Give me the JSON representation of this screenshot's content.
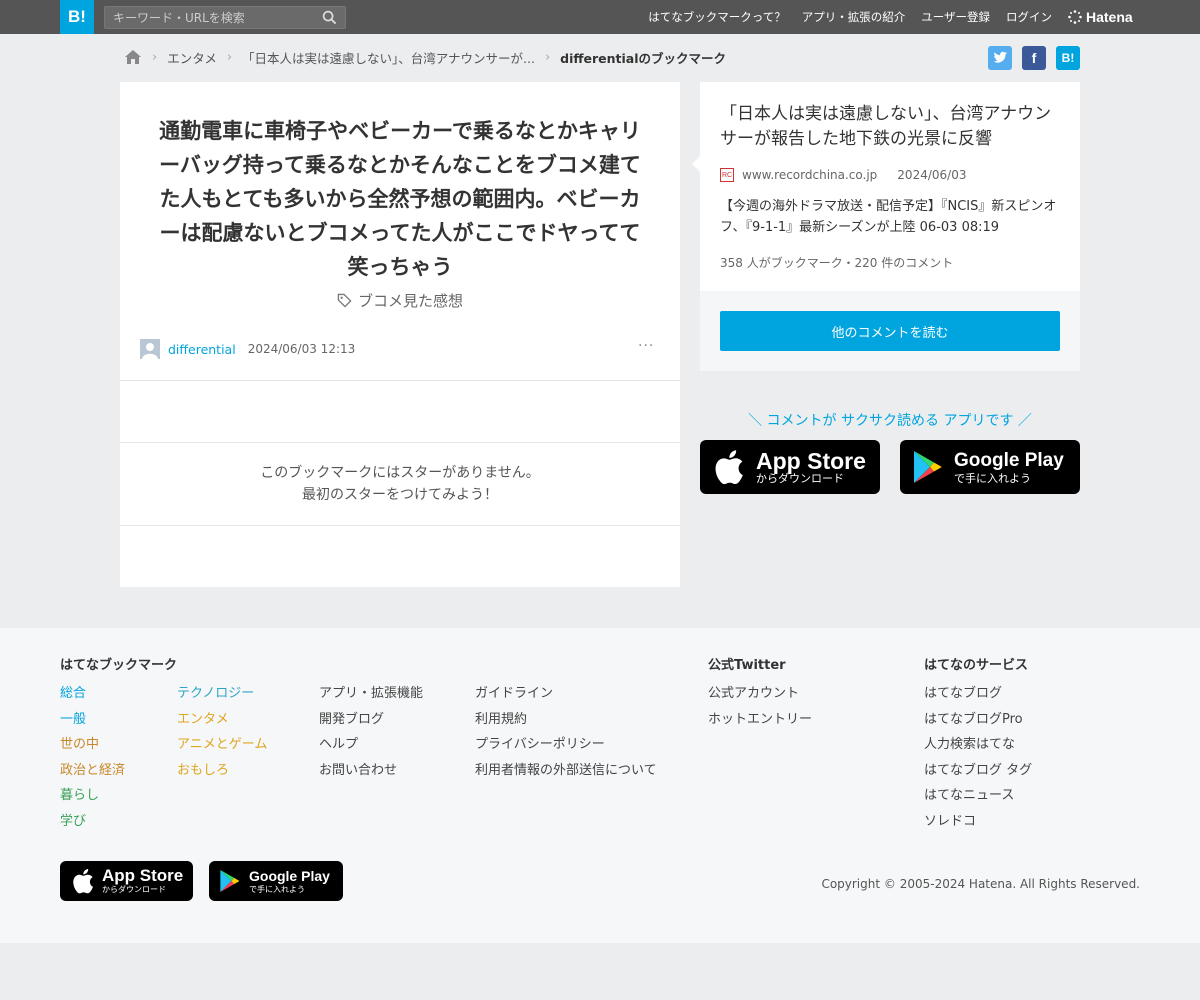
{
  "header": {
    "logo": "B!",
    "search_placeholder": "キーワード・URLを検索",
    "nav": [
      "はてなブックマークって？",
      "アプリ・拡張の紹介",
      "ユーザー登録",
      "ログイン"
    ],
    "brand": "Hatena"
  },
  "breadcrumb": {
    "items": [
      "エンタメ",
      "「日本人は実は遠慮しない」、台湾アナウンサーが...",
      "differentialのブックマーク"
    ]
  },
  "share": {
    "twitter": "t",
    "facebook": "f",
    "hatena": "B!"
  },
  "bookmark": {
    "comment": "通勤電車に車椅子やベビーカーで乗るなとかキャリーバッグ持って乗るなとかそんなことをブコメ建てた人もとても多いから全然予想の範囲内。ベビーカーは配慮ないとブコメってた人がここでドヤってて笑っちゃう",
    "tag": "ブコメ見た感想",
    "user": "differential",
    "date": "2024/06/03 12:13",
    "more": "···",
    "no_star_line1": "このブックマークにはスターがありません。",
    "no_star_line2": "最初のスターをつけてみよう！"
  },
  "entry": {
    "title": "「日本人は実は遠慮しない」、台湾アナウンサーが報告した地下鉄の光景に反響",
    "favicon": "RC",
    "domain": "www.recordchina.co.jp",
    "date": "2024/06/03",
    "summary": "【今週の海外ドラマ放送・配信予定】『NCIS』新スピンオフ、『9-1-1』最新シーズンが上陸 06-03 08:19",
    "count": "358 人がブックマーク・220 件のコメント",
    "read_more": "他のコメントを読む"
  },
  "app_promo": {
    "text": "＼ コメントが サクサク読める アプリです ／",
    "appstore_big": "App Store",
    "appstore_small": "からダウンロード",
    "googleplay_big": "Google Play",
    "googleplay_small": "で手に入れよう"
  },
  "footer": {
    "col1_title": "はてなブックマーク",
    "categories_a": [
      "総合",
      "一般",
      "世の中",
      "政治と経済",
      "暮らし",
      "学び"
    ],
    "categories_b": [
      "テクノロジー",
      "エンタメ",
      "アニメとゲーム",
      "おもしろ"
    ],
    "links_c": [
      "アプリ・拡張機能",
      "開発ブログ",
      "ヘルプ",
      "お問い合わせ"
    ],
    "links_d": [
      "ガイドライン",
      "利用規約",
      "プライバシーポリシー",
      "利用者情報の外部送信について"
    ],
    "twitter_title": "公式Twitter",
    "twitter_links": [
      "公式アカウント",
      "ホットエントリー"
    ],
    "services_title": "はてなのサービス",
    "services": [
      "はてなブログ",
      "はてなブログPro",
      "人力検索はてな",
      "はてなブログ タグ",
      "はてなニュース",
      "ソレドコ"
    ],
    "copyright": "Copyright © 2005-2024 Hatena. All Rights Reserved."
  },
  "colors": {
    "accent": "#00a4de",
    "cat_general": "#00a4de",
    "cat_society": "#c8882a",
    "cat_life": "#3aa157",
    "cat_tech": "#2fa4c4",
    "cat_ent": "#e0a520"
  }
}
